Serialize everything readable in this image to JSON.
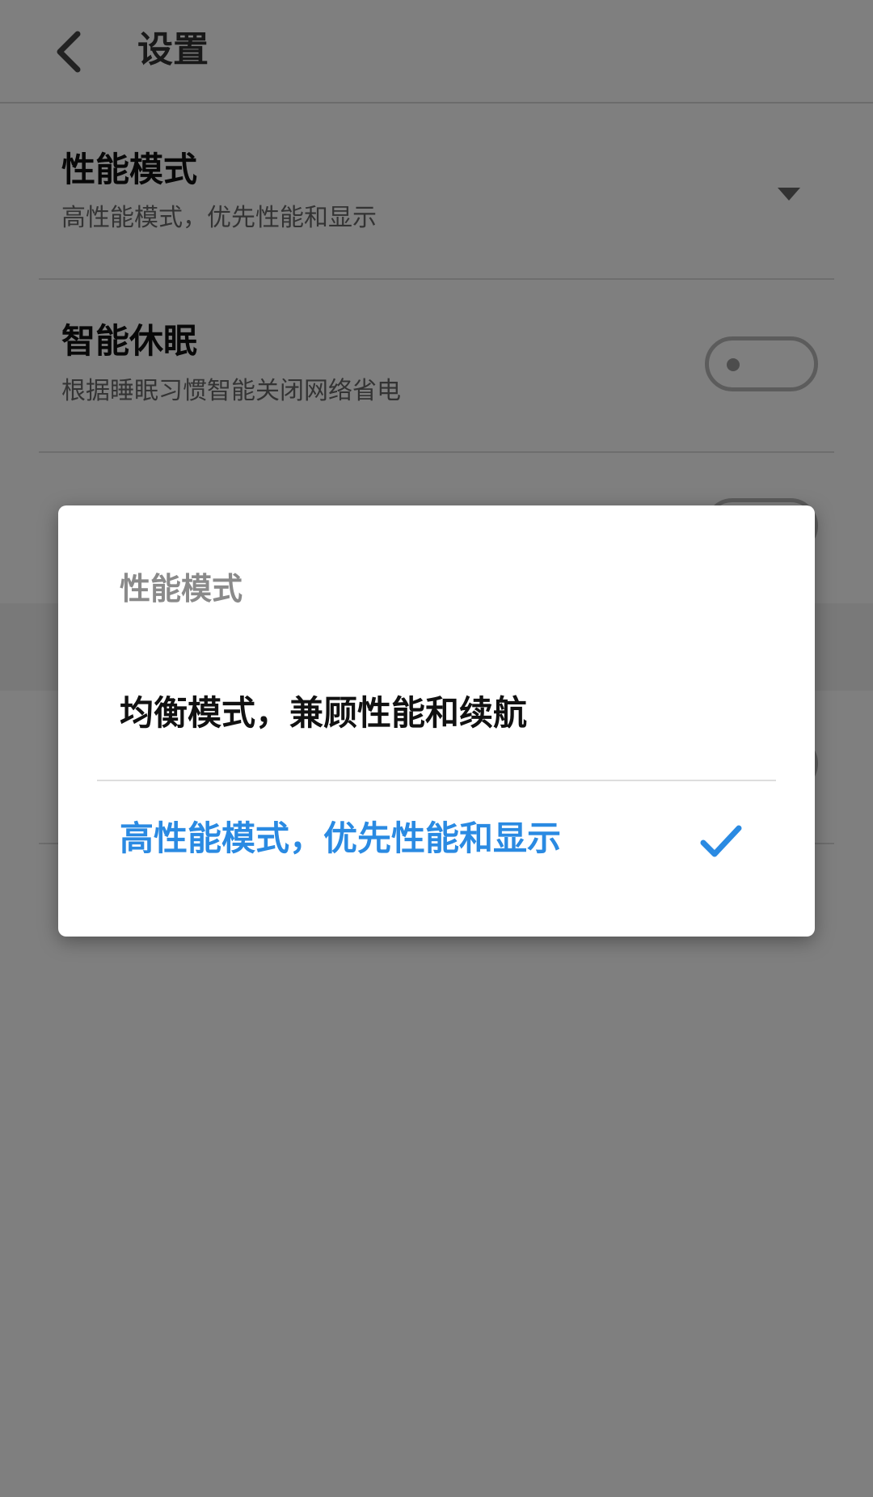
{
  "header": {
    "title": "设置"
  },
  "settings": [
    {
      "title": "性能模式",
      "description": "高性能模式，优先性能和显示",
      "control": "dropdown"
    },
    {
      "title": "智能休眠",
      "description": "根据睡眠习惯智能关闭网络省电",
      "control": "toggle",
      "enabled": false
    }
  ],
  "dialog": {
    "title": "性能模式",
    "options": [
      {
        "label": "均衡模式，兼顾性能和续航",
        "selected": false
      },
      {
        "label": "高性能模式，优先性能和显示",
        "selected": true
      }
    ]
  },
  "colors": {
    "accent": "#2a8ae2",
    "scrim": "rgba(0,0,0,0.5)"
  },
  "icons": {
    "back": "chevron-left-icon",
    "dropdown": "caret-down-icon",
    "selected": "checkmark-icon"
  }
}
